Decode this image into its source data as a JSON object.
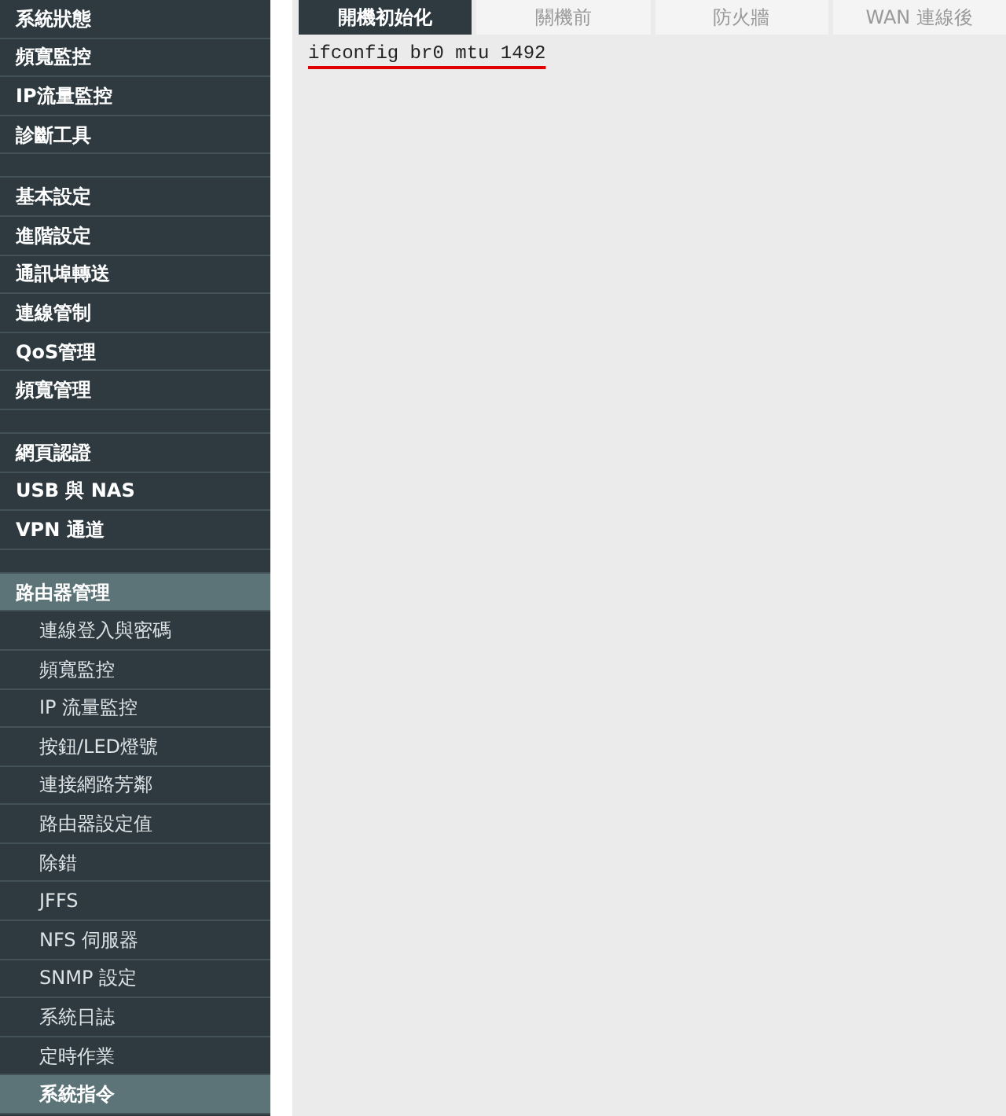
{
  "sidebar": {
    "groups": [
      {
        "items": [
          {
            "label": "系統狀態",
            "selected": false
          },
          {
            "label": "頻寬監控",
            "selected": false
          },
          {
            "label": "IP流量監控",
            "selected": false
          },
          {
            "label": "診斷工具",
            "selected": false
          }
        ]
      },
      {
        "items": [
          {
            "label": "基本設定",
            "selected": false
          },
          {
            "label": "進階設定",
            "selected": false
          },
          {
            "label": "通訊埠轉送",
            "selected": false
          },
          {
            "label": "連線管制",
            "selected": false
          },
          {
            "label": "QoS管理",
            "selected": false
          },
          {
            "label": "頻寬管理",
            "selected": false
          }
        ]
      },
      {
        "items": [
          {
            "label": "網頁認證",
            "selected": false
          },
          {
            "label": "USB 與 NAS",
            "selected": false
          },
          {
            "label": "VPN 通道",
            "selected": false
          }
        ]
      },
      {
        "items": [
          {
            "label": "路由器管理",
            "selected": true,
            "children": [
              {
                "label": "連線登入與密碼",
                "selected": false
              },
              {
                "label": "頻寬監控",
                "selected": false
              },
              {
                "label": "IP 流量監控",
                "selected": false
              },
              {
                "label": "按鈕/LED燈號",
                "selected": false
              },
              {
                "label": "連接網路芳鄰",
                "selected": false
              },
              {
                "label": "路由器設定值",
                "selected": false
              },
              {
                "label": "除錯",
                "selected": false
              },
              {
                "label": "JFFS",
                "selected": false
              },
              {
                "label": "NFS 伺服器",
                "selected": false
              },
              {
                "label": "SNMP 設定",
                "selected": false
              },
              {
                "label": "系統日誌",
                "selected": false
              },
              {
                "label": "定時作業",
                "selected": false
              },
              {
                "label": "系統指令",
                "selected": true
              }
            ]
          }
        ]
      }
    ]
  },
  "tabs": [
    {
      "label": "開機初始化",
      "selected": true
    },
    {
      "label": "關機前",
      "selected": false
    },
    {
      "label": "防火牆",
      "selected": false
    },
    {
      "label": "WAN 連線後",
      "selected": false
    }
  ],
  "command": {
    "value": "ifconfig br0 mtu 1492",
    "spelling_error": true
  }
}
